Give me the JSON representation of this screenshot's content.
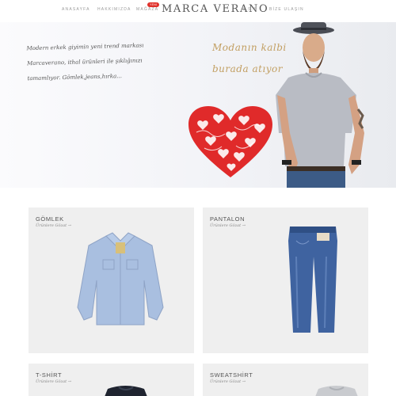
{
  "nav": {
    "items": [
      "ANASAYFA",
      "HAKKIMIZDA",
      "MAĞAZA",
      "S.S.S",
      "BİZE ULAŞIN"
    ],
    "badge": "YENİ",
    "logo": "MARCA VERANO"
  },
  "hero": {
    "intro_line1": "Modern erkek giyimin yeni trend markası",
    "intro_line2": "Marcaverano, ithal ürünleri ile şıklığınızı",
    "intro_line3": "tamamlıyor. Gömlek,jeans,hırka...",
    "tagline_1": "Modanın kalbi",
    "tagline_2": "burada atıyor",
    "accent_color": "#c29f62",
    "heart_color": "#e02a2a"
  },
  "categories": [
    {
      "title": "GÖMLEK",
      "link": "Ürünlere Gözat →"
    },
    {
      "title": "PANTALON",
      "link": "Ürünlere Gözat →"
    },
    {
      "title": "T-SHİRT",
      "link": "Ürünlere Gözat →"
    },
    {
      "title": "SWEATSHİRT",
      "link": "Ürünlere Gözat →"
    }
  ]
}
